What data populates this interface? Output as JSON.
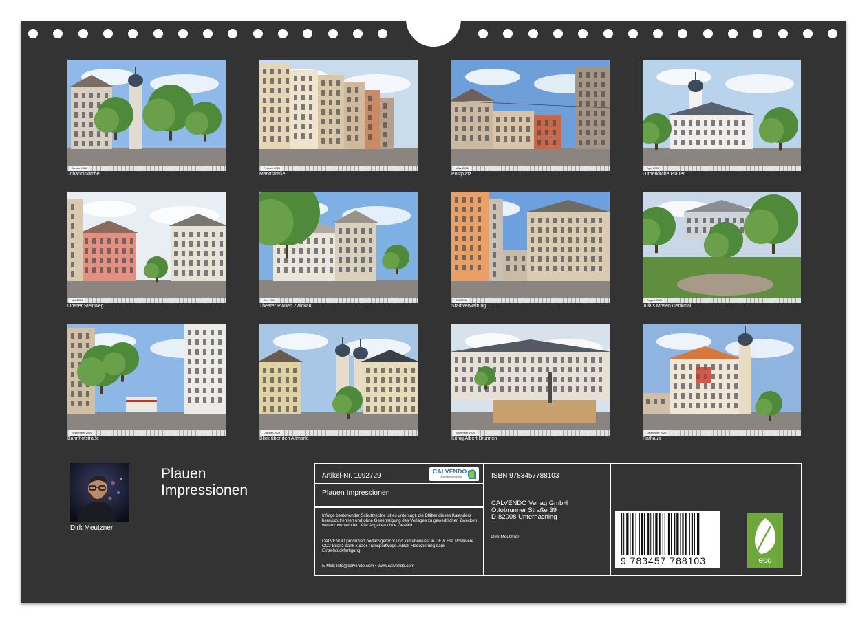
{
  "months": [
    {
      "caption": "Johanniskirche",
      "label": "Januar 2026",
      "theme": "church-old"
    },
    {
      "caption": "Marktstraße",
      "label": "Februar 2026",
      "theme": "street"
    },
    {
      "caption": "Postplatz",
      "label": "März 2026",
      "theme": "square-tram"
    },
    {
      "caption": "Lutherkirche Plauen",
      "label": "April 2026",
      "theme": "white-church"
    },
    {
      "caption": "Oberer Steinweg",
      "label": "Mai 2026",
      "theme": "pink-house"
    },
    {
      "caption": "Theater Plauen Zwickau",
      "label": "Juni 2026",
      "theme": "theater"
    },
    {
      "caption": "Stadtverwaltung",
      "label": "Juli 2026",
      "theme": "admin"
    },
    {
      "caption": "Julius Mosen Denkmal",
      "label": "August 2026",
      "theme": "park"
    },
    {
      "caption": "Bahnhofstraße",
      "label": "September 2026",
      "theme": "tram-street"
    },
    {
      "caption": "Blick über den Altmarkt",
      "label": "Oktober 2026",
      "theme": "altmarkt"
    },
    {
      "caption": "König Albert Brunnen",
      "label": "November 2026",
      "theme": "fountain"
    },
    {
      "caption": "Rathaus",
      "label": "Dezember 2026",
      "theme": "townhall"
    }
  ],
  "author": {
    "name": "Dirk Meutzner"
  },
  "calendar_title": [
    "Plauen",
    "Impressionen"
  ],
  "imprint": {
    "article_no": "Artikel-Nr. 1992729",
    "logo_text": "CALVENDO",
    "logo_sub": "Dein Kalenderverlag",
    "title": "Plauen Impressionen",
    "legal_1": "Infolge bestehender Schutzrechte ist es untersagt, die Blätter dieses Kalenders herauszutrennen und ohne Genehmigung des Verlages zu gewerblichen Zwecken weiterzuverwenden. Alle Angaben ohne Gewähr.",
    "legal_2": "CALVENDO produziert bedarfsgerecht und klimabewusst in DE & EU. Positivere CO2-Bilanz dank kurzer Transportwege. Abfall-Reduzierung dank Einzelstückfertigung.",
    "email": "E-Mail: info@calvendo.com • www.calvendo.com",
    "isbn": "ISBN 9783457788103",
    "publisher": "CALVENDO Verlag GmbH",
    "street": "Ottobrunner Straße 39",
    "city": "D-82008 Unterhaching",
    "author_small": "Dirk Meutzner",
    "barcode_digits": "9 783457 788103",
    "eco_label": "eco"
  },
  "colors": {
    "background": "#333333",
    "text": "#ffffff",
    "eco_green": "#6ea83a",
    "calvendo_teal": "#1f6f86"
  }
}
